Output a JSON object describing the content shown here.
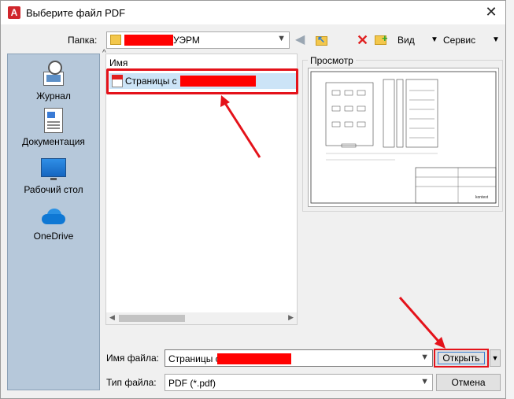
{
  "window": {
    "title": "Выберите файл PDF",
    "icon": "A"
  },
  "toolbar": {
    "folder_label": "Папка:",
    "folder_value": "УЭРМ",
    "view_label": "Вид",
    "tools_label": "Сервис"
  },
  "places": [
    {
      "label": "Журнал",
      "icon": "history-icon"
    },
    {
      "label": "Документация",
      "icon": "documents-icon"
    },
    {
      "label": "Рабочий стол",
      "icon": "desktop-icon"
    },
    {
      "label": "OneDrive",
      "icon": "onedrive-icon"
    }
  ],
  "file_list": {
    "column_name": "Имя",
    "files": [
      {
        "name": "Страницы с",
        "selected": true
      }
    ]
  },
  "preview": {
    "label": "Просмотр"
  },
  "form": {
    "filename_label": "Имя файла:",
    "filename_value": "Страницы с",
    "filetype_label": "Тип файла:",
    "filetype_value": "PDF (*.pdf)"
  },
  "buttons": {
    "open": "Открыть",
    "cancel": "Отмена"
  },
  "preview_drawing_texts": [
    "kontext"
  ],
  "colors": {
    "annotation": "#e4121a",
    "selection": "#cce4f7",
    "places_bg": "#b6c8da"
  }
}
